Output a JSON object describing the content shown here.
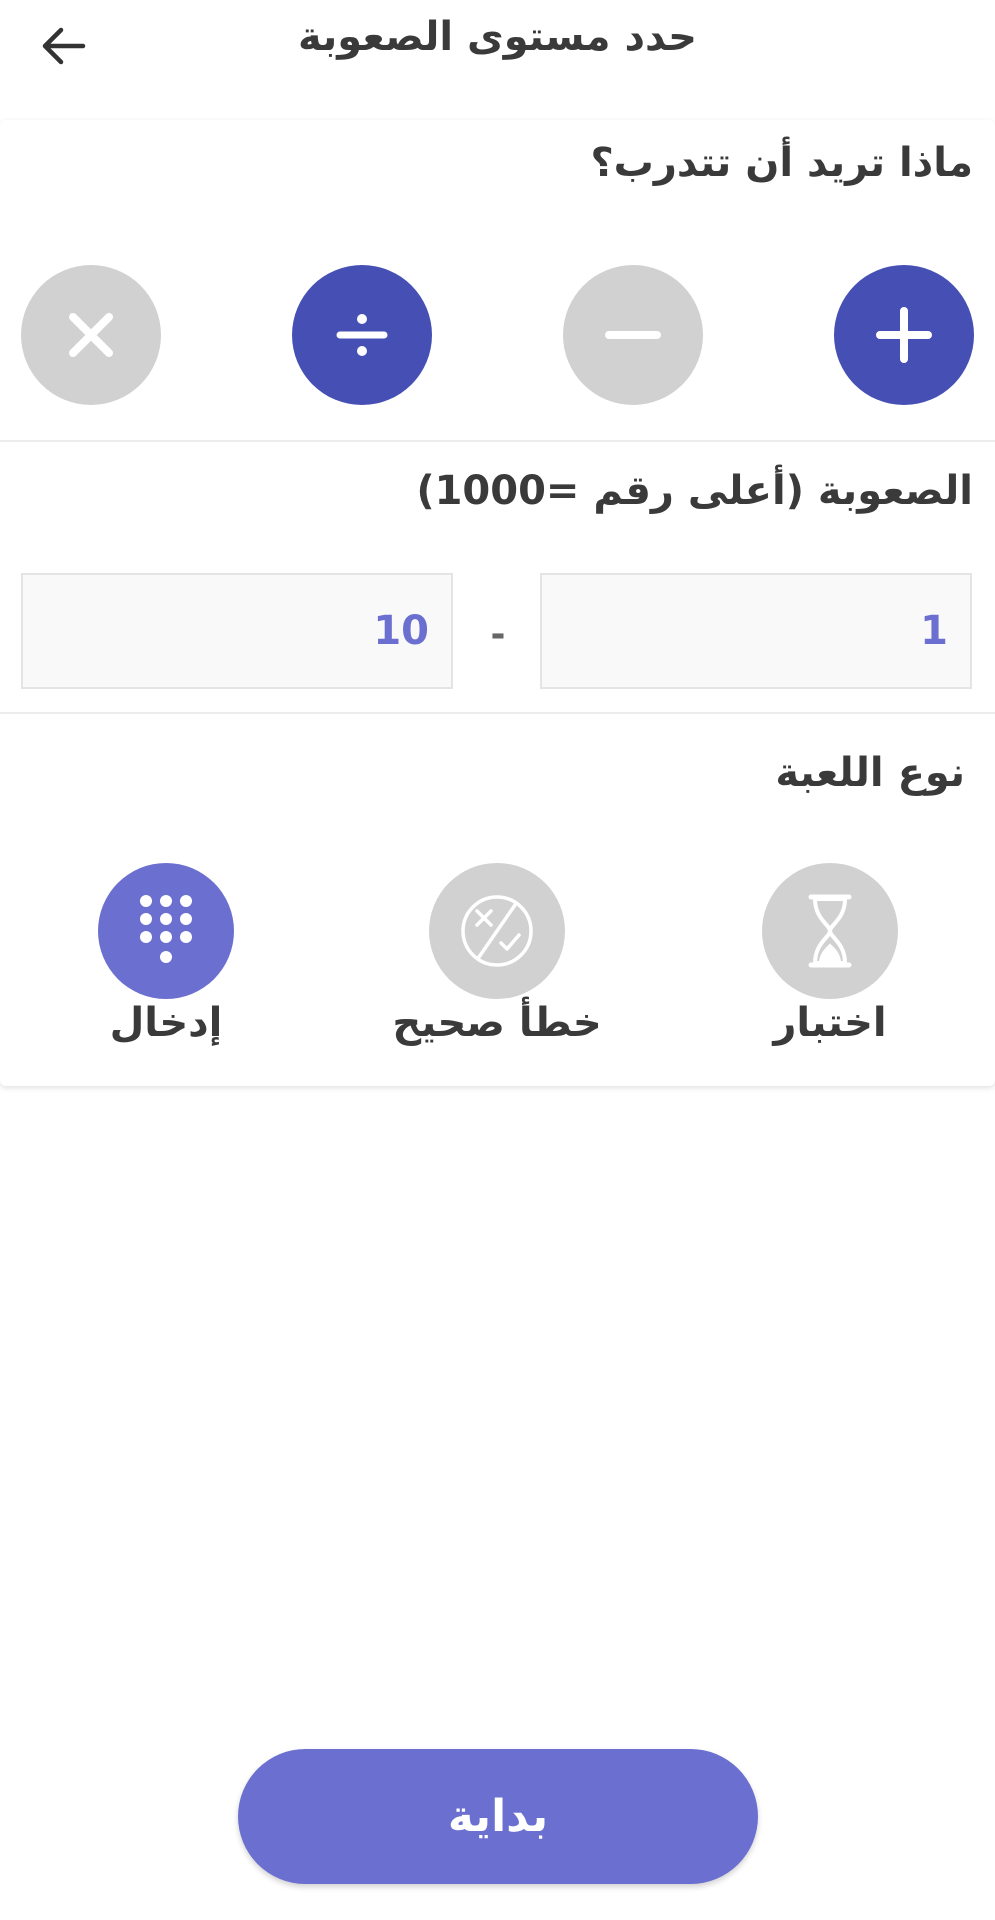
{
  "header": {
    "title": "حدد مستوى الصعوبة",
    "back_icon": "arrow-left-icon"
  },
  "operations": {
    "title": "ماذا تريد أن تتدرب؟",
    "items": [
      {
        "name": "addition",
        "icon": "plus-icon",
        "selected": true
      },
      {
        "name": "subtraction",
        "icon": "minus-icon",
        "selected": false
      },
      {
        "name": "division",
        "icon": "divide-icon",
        "selected": true
      },
      {
        "name": "multiplication",
        "icon": "multiply-icon",
        "selected": false
      }
    ]
  },
  "difficulty": {
    "title": "الصعوبة (أعلى رقم =1000)",
    "min_value": "1",
    "max_value": "10",
    "separator": "-"
  },
  "game_type": {
    "title": "نوع اللعبة",
    "modes": [
      {
        "label": "اختبار",
        "icon": "hourglass-icon",
        "selected": false
      },
      {
        "label": "خطأ صحيح",
        "icon": "true-false-icon",
        "selected": false
      },
      {
        "label": "إدخال",
        "icon": "keypad-icon",
        "selected": true
      }
    ]
  },
  "start_button": {
    "label": "بداية"
  },
  "colors": {
    "primary": "#4650b4",
    "accent": "#6a6fd0",
    "inactive": "#d1d1d1"
  }
}
